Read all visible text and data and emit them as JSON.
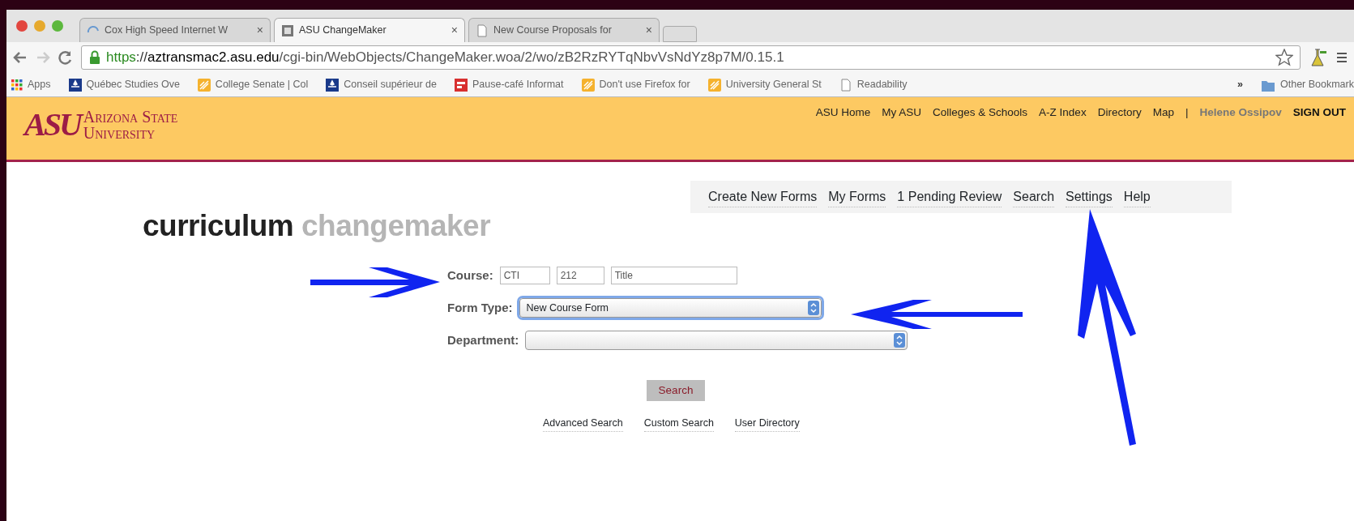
{
  "browser": {
    "tabs": [
      {
        "title": "Cox High Speed Internet W",
        "selected": false,
        "kind": "loading",
        "close": "×"
      },
      {
        "title": "ASU ChangeMaker",
        "selected": true,
        "kind": "app",
        "close": "×"
      },
      {
        "title": "New Course Proposals for",
        "selected": false,
        "kind": "page",
        "close": "×"
      }
    ],
    "url": {
      "scheme": "https",
      "separator": "://",
      "host": "aztransmac2.asu.edu",
      "path": "/cgi-bin/WebObjects/ChangeMaker.woa/2/wo/zB2RzRYTqNbvVsNdYz8p7M/0.15.1"
    },
    "apps_label": "Apps",
    "bookmarks": [
      {
        "label": "Québec Studies Ove",
        "kind": "flag"
      },
      {
        "label": "College Senate | Col",
        "kind": "asu"
      },
      {
        "label": "Conseil supérieur de",
        "kind": "flag"
      },
      {
        "label": "Pause-café Informat",
        "kind": "red"
      },
      {
        "label": "Don't use Firefox for",
        "kind": "asu"
      },
      {
        "label": "University General St",
        "kind": "asu"
      },
      {
        "label": "Readability",
        "kind": "page"
      }
    ],
    "more": "»",
    "other_bookmarks": "Other Bookmark"
  },
  "header": {
    "logo_mark": "ASU",
    "logo_line1": "Arizona State",
    "logo_line2": "University",
    "links": [
      "ASU Home",
      "My ASU",
      "Colleges & Schools",
      "A-Z Index",
      "Directory",
      "Map"
    ],
    "separator": "|",
    "user": "Helene Ossipov",
    "sign_out": "SIGN OUT"
  },
  "app_nav": [
    "Create New Forms",
    "My Forms",
    "1 Pending Review",
    "Search",
    "Settings",
    "Help"
  ],
  "app_title": {
    "first": "curriculum",
    "second": "changemaker"
  },
  "form": {
    "course_label": "Course:",
    "course_fields": [
      "CTI",
      "212",
      "Title"
    ],
    "form_type_label": "Form Type:",
    "form_type": {
      "value": "New Course Form",
      "focused": true
    },
    "department_label": "Department:",
    "department": {
      "focused": false
    },
    "search_button": "Search",
    "links": [
      "Advanced Search",
      "Custom Search",
      "User Directory"
    ]
  }
}
